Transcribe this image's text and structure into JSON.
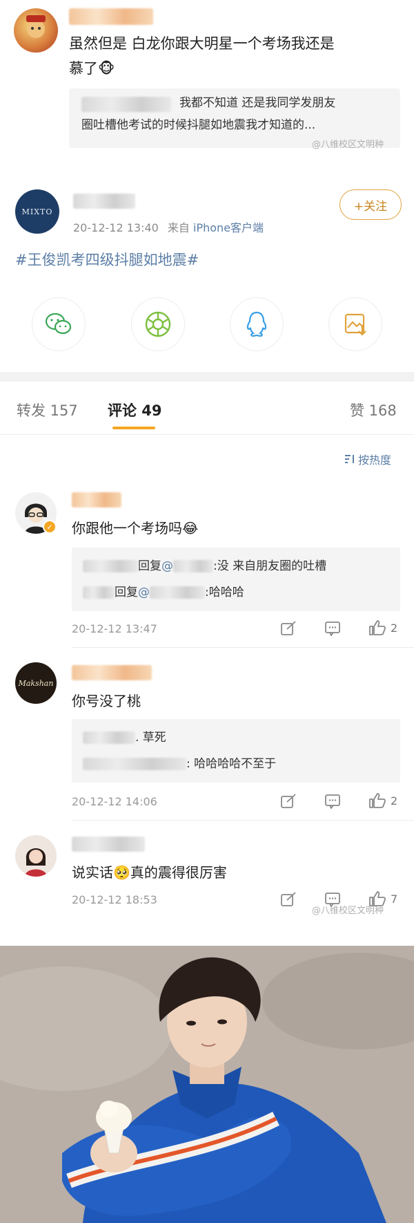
{
  "top_comment": {
    "text_line1": "虽然但是 白龙你跟大明星一个考场我还是",
    "text_line2": "慕了🐵",
    "quote_line1": "我都不知道 还是我同学发朋友",
    "quote_line2": "圈吐槽他考试的时候抖腿如地震我才知道的...",
    "watermark": "@八维校区文明种"
  },
  "post": {
    "time": "20-12-12 13:40",
    "source_prefix": "来自",
    "source": "iPhone客户端",
    "follow_label": "+关注",
    "hashtag": "#王俊凯考四级抖腿如地震#",
    "avatar_text": "MIXTO",
    "share_icons": [
      "wechat-icon",
      "moments-icon",
      "qq-icon",
      "save-image-icon"
    ]
  },
  "tabs": {
    "repost": "转发 157",
    "comment": "评论 49",
    "like": "赞 168",
    "sort": "按热度"
  },
  "comments": [
    {
      "text": "你跟他一个考场吗😂",
      "replies": [
        {
          "prefix": "回复",
          "at": "@",
          "text": ":没 来自朋友圈的吐槽"
        },
        {
          "prefix": "回复",
          "at": "@",
          "text": ":哈哈哈"
        }
      ],
      "time": "20-12-12 13:47",
      "likes": "2"
    },
    {
      "text": "你号没了桃",
      "replies": [
        {
          "prefix": "",
          "at": "",
          "text": ". 草死"
        },
        {
          "prefix": "",
          "at": "",
          "text": ": 哈哈哈哈不至于"
        }
      ],
      "time": "20-12-12 14:06",
      "likes": "2",
      "avatar_text": "Makshan"
    },
    {
      "text": "说实话🥺真的震得很厉害",
      "time": "20-12-12 18:53",
      "likes": "7",
      "watermark": "@八维校区文明种"
    }
  ],
  "colors": {
    "accent": "#f6a623",
    "link": "#5b7ea6",
    "follow": "#c8841f"
  }
}
